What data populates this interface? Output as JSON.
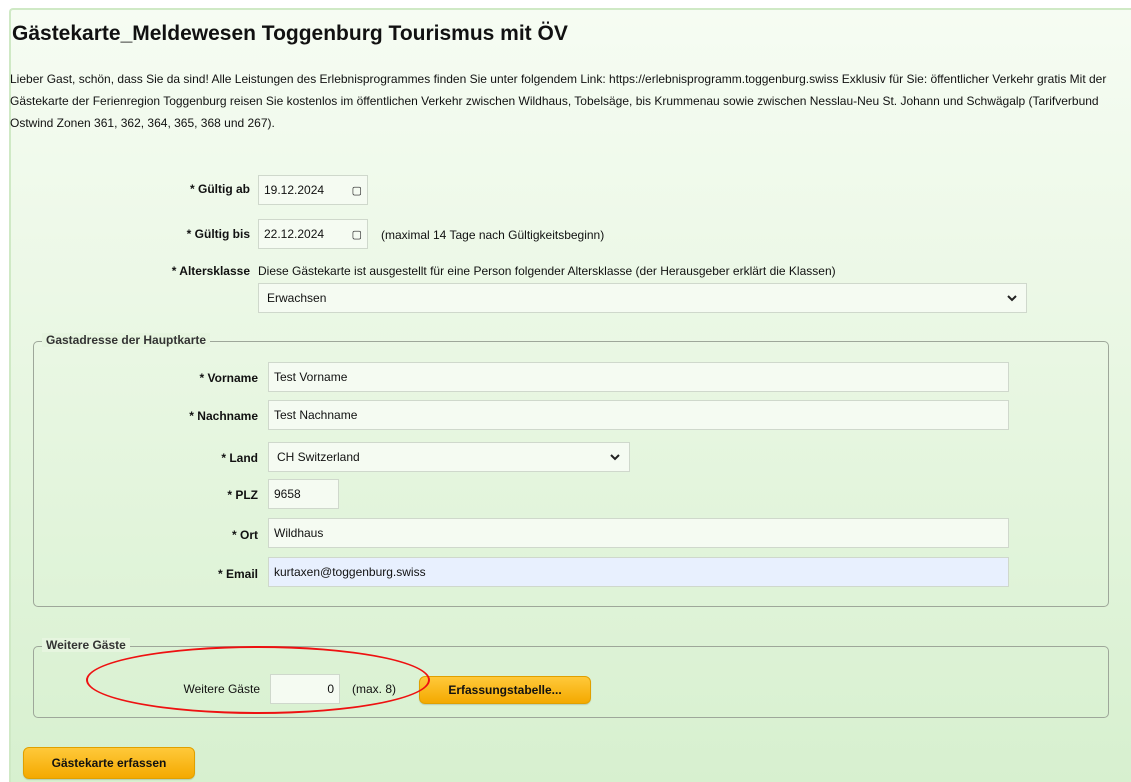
{
  "title": "Gästekarte_Meldewesen Toggenburg Tourismus mit ÖV",
  "intro": "Lieber Gast, schön, dass Sie da sind! Alle Leistungen des Erlebnisprogrammes finden Sie unter folgendem Link: https://erlebnisprogramm.toggenburg.swiss Exklusiv für Sie: öffentlicher Verkehr gratis Mit der Gästekarte der Ferienregion Toggenburg reisen Sie kostenlos im öffentlichen Verkehr zwischen Wildhaus, Tobelsäge, bis Krummenau sowie zwischen Nesslau-Neu St. Johann und Schwägalp (Tarifverbund Ostwind Zonen 361, 362, 364, 365, 368 und 267).",
  "validity": {
    "from_label": "* Gültig ab",
    "from_value": "19.12.2024",
    "to_label": "* Gültig bis",
    "to_value": "22.12.2024",
    "to_note": "(maximal 14 Tage nach Gültigkeitsbeginn)"
  },
  "age": {
    "label": "* Altersklasse",
    "description": "Diese Gästekarte ist ausgestellt für eine Person folgender Altersklasse (der Herausgeber erklärt die Klassen)",
    "value": "Erwachsen"
  },
  "address": {
    "legend": "Gastadresse der Hauptkarte",
    "firstname_label": "* Vorname",
    "firstname_value": "Test Vorname",
    "lastname_label": "* Nachname",
    "lastname_value": "Test Nachname",
    "country_label": "* Land",
    "country_value": "CH Switzerland",
    "zip_label": "* PLZ",
    "zip_value": "9658",
    "city_label": "* Ort",
    "city_value": "Wildhaus",
    "email_label": "* Email",
    "email_value": "kurtaxen@toggenburg.swiss"
  },
  "guests": {
    "legend": "Weitere Gäste",
    "label": "Weitere Gäste",
    "value": "0",
    "max_note": "(max. 8)",
    "table_button": "Erfassungstabelle..."
  },
  "submit_button": "Gästekarte erfassen",
  "colors": {
    "button": "#f4a900",
    "highlight": "#e11111",
    "autofill": "#e8f0fe"
  }
}
